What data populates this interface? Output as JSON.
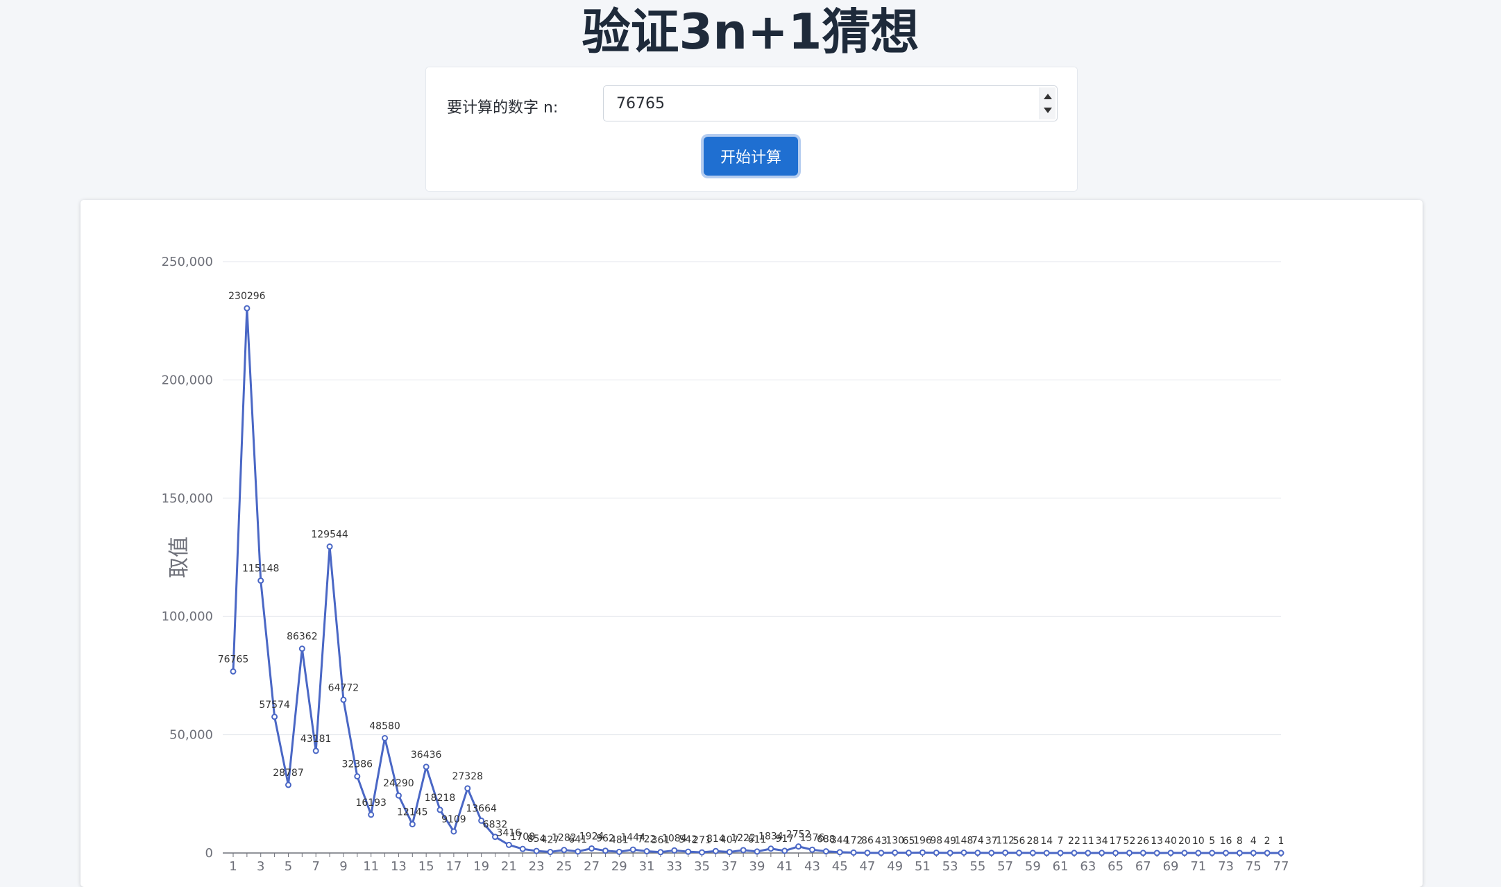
{
  "header": {
    "title": "验证3n+1猜想"
  },
  "form": {
    "label": "要计算的数字 n:",
    "value": "76765",
    "submit_label": "开始计算"
  },
  "colors": {
    "accent": "#1f6fd1",
    "series": "#4a67c5"
  },
  "chart_data": {
    "type": "line",
    "ylabel": "取值",
    "xlabel": "",
    "ylim": [
      0,
      250000
    ],
    "yticks": [
      0,
      50000,
      100000,
      150000,
      200000,
      250000
    ],
    "ytick_labels": [
      "0",
      "50,000",
      "100,000",
      "150,000",
      "200,000",
      "250,000"
    ],
    "x": [
      1,
      2,
      3,
      4,
      5,
      6,
      7,
      8,
      9,
      10,
      11,
      12,
      13,
      14,
      15,
      16,
      17,
      18,
      19,
      20,
      21,
      22,
      23,
      24,
      25,
      26,
      27,
      28,
      29,
      30,
      31,
      32,
      33,
      34,
      35,
      36,
      37,
      38,
      39,
      40,
      41,
      42,
      43,
      44,
      45,
      46,
      47,
      48,
      49,
      50,
      51,
      52,
      53,
      54,
      55,
      56,
      57,
      58,
      59,
      60,
      61,
      62,
      63,
      64,
      65,
      66,
      67,
      68,
      69,
      70,
      71,
      72,
      73,
      74,
      75,
      76,
      77
    ],
    "xtick_labels": [
      "1",
      "3",
      "5",
      "7",
      "9",
      "11",
      "13",
      "15",
      "17",
      "19",
      "21",
      "23",
      "25",
      "27",
      "29",
      "31",
      "33",
      "35",
      "37",
      "39",
      "41",
      "43",
      "45",
      "47",
      "49",
      "51",
      "53",
      "55",
      "57",
      "59",
      "61",
      "63",
      "65",
      "67",
      "69",
      "71",
      "73",
      "75",
      "77"
    ],
    "values": [
      76765,
      230296,
      115148,
      57574,
      28787,
      86362,
      43181,
      129544,
      64772,
      32386,
      16193,
      48580,
      24290,
      12145,
      36436,
      18218,
      9109,
      27328,
      13664,
      6832,
      3416,
      1708,
      854,
      427,
      1282,
      641,
      1924,
      962,
      481,
      1444,
      722,
      361,
      1084,
      542,
      271,
      814,
      407,
      1222,
      611,
      1834,
      917,
      2752,
      1376,
      688,
      344,
      172,
      86,
      43,
      130,
      65,
      196,
      98,
      49,
      148,
      74,
      37,
      112,
      56,
      28,
      14,
      7,
      22,
      11,
      34,
      17,
      52,
      26,
      13,
      40,
      20,
      10,
      5,
      16,
      8,
      4,
      2,
      1
    ],
    "grid": true
  }
}
